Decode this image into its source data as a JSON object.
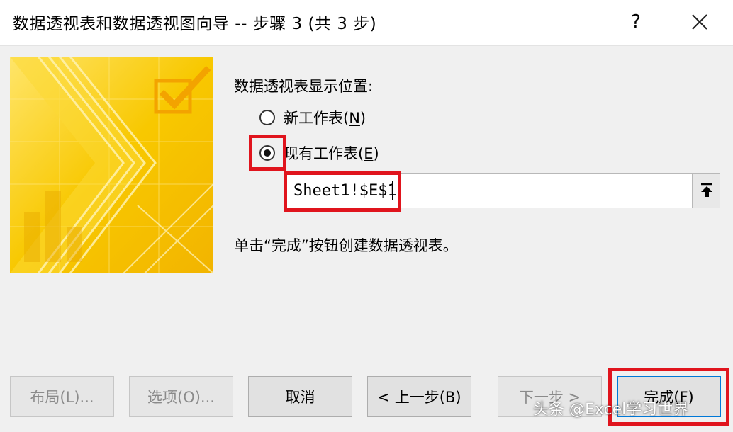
{
  "window": {
    "title": "数据透视表和数据透视图向导 -- 步骤 3 (共 3 步)",
    "help_label": "?",
    "close_icon": "close-icon"
  },
  "placement": {
    "section_label": "数据透视表显示位置:",
    "options": [
      {
        "label": "新工作表(",
        "accel": "N",
        "suffix": ")",
        "checked": false
      },
      {
        "label": "现有工作表(",
        "accel": "E",
        "suffix": ")",
        "checked": true
      }
    ],
    "location_value": "Sheet1!$E$1",
    "collapse_icon": "upload-arrow-icon"
  },
  "info_text": "单击“完成”按钮创建数据透视表。",
  "buttons": {
    "layout": "布局(L)...",
    "options": "选项(O)...",
    "cancel": "取消",
    "back": "< 上一步(B)",
    "next": "下一步 >",
    "finish": "完成(F)"
  },
  "watermark": "头条 @Excel学习世界",
  "colors": {
    "highlight": "#e0141d",
    "art_yellow": "#f6c400",
    "art_light": "#ffe66b",
    "focus_blue": "#0078d7"
  }
}
